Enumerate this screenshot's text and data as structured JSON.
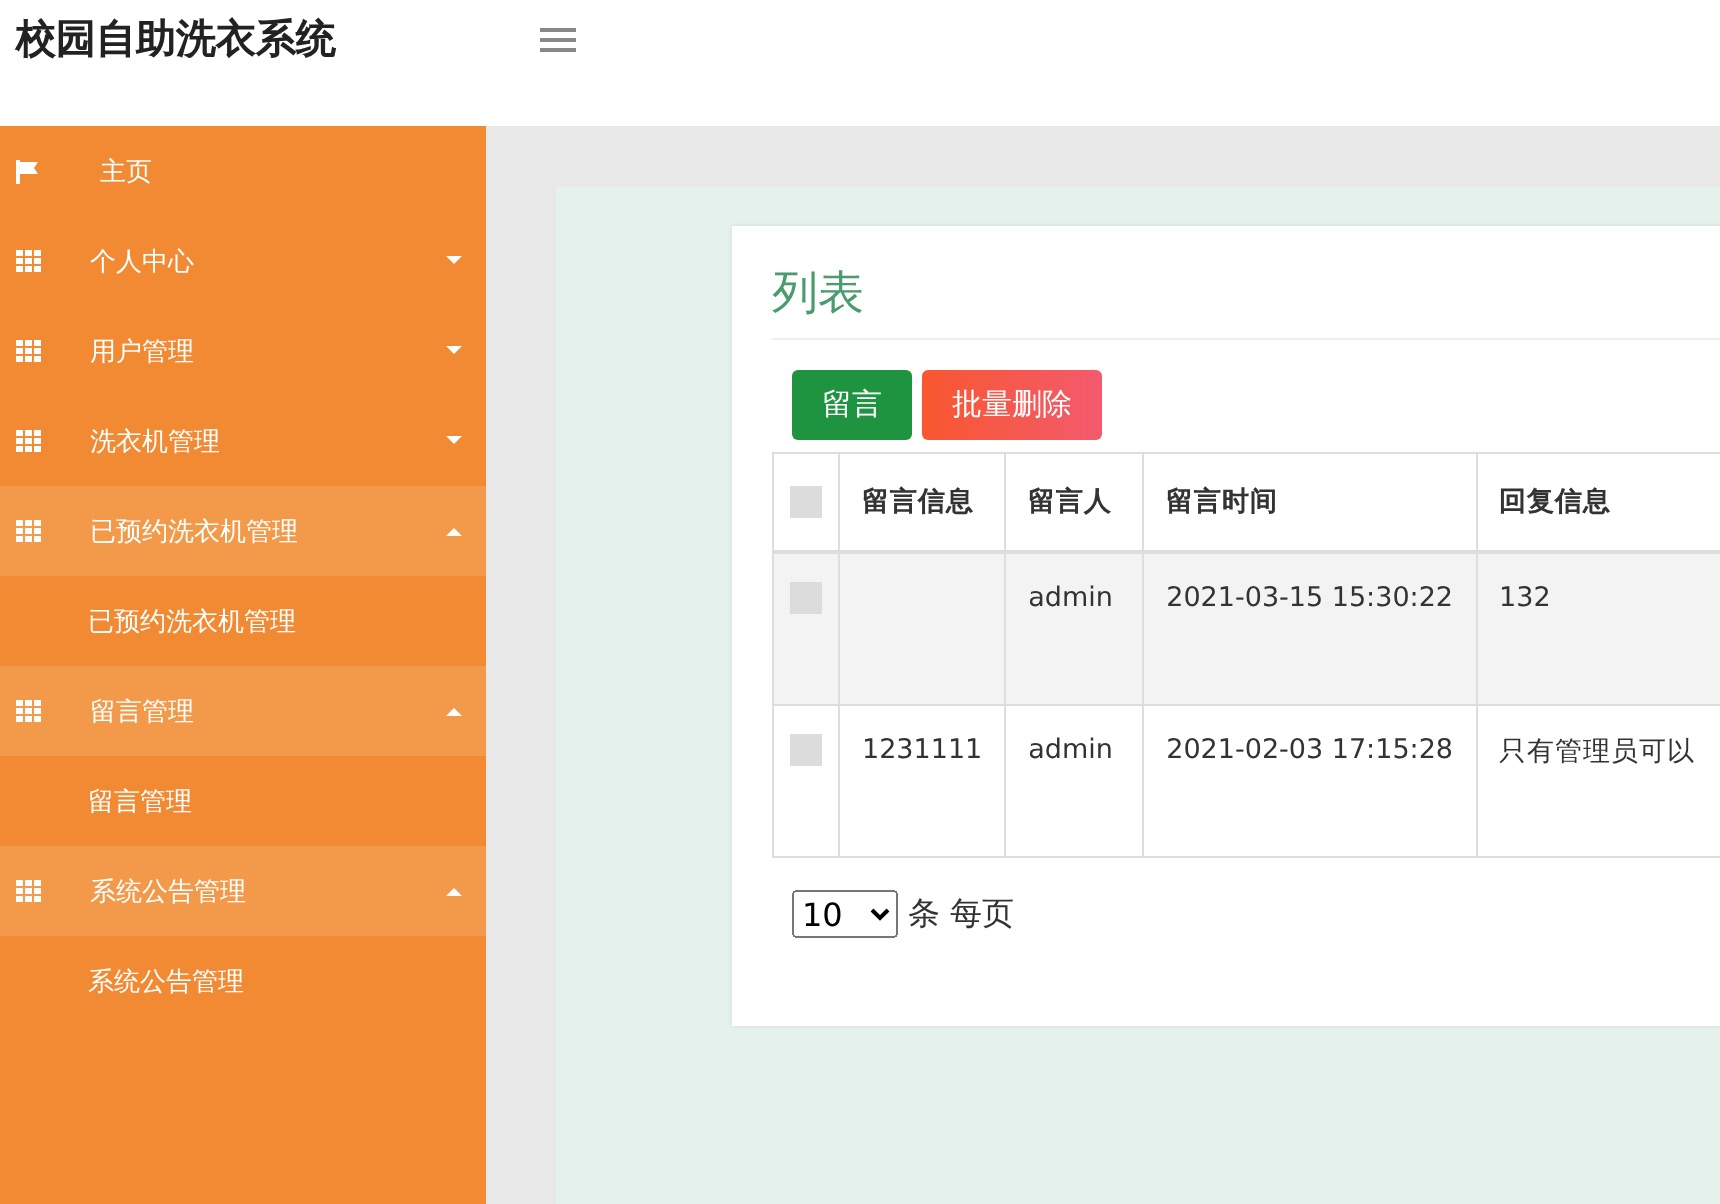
{
  "header": {
    "title": "校园自助洗衣系统"
  },
  "sidebar": {
    "items": [
      {
        "kind": "home",
        "label": "主页",
        "expanded": false
      },
      {
        "kind": "group",
        "label": "个人中心",
        "expanded": false
      },
      {
        "kind": "group",
        "label": "用户管理",
        "expanded": false
      },
      {
        "kind": "group",
        "label": "洗衣机管理",
        "expanded": false
      },
      {
        "kind": "group",
        "label": "已预约洗衣机管理",
        "expanded": true,
        "children": [
          {
            "label": "已预约洗衣机管理"
          }
        ]
      },
      {
        "kind": "group",
        "label": "留言管理",
        "expanded": true,
        "children": [
          {
            "label": "留言管理"
          }
        ]
      },
      {
        "kind": "group",
        "label": "系统公告管理",
        "expanded": true,
        "children": [
          {
            "label": "系统公告管理"
          }
        ]
      }
    ]
  },
  "card": {
    "title": "列表",
    "buttons": [
      {
        "kind": "add",
        "label": "留言"
      },
      {
        "kind": "delete",
        "label": "批量删除"
      }
    ],
    "table": {
      "select_all": {
        "checked": false
      },
      "columns": [
        "留言信息",
        "留言人",
        "留言时间",
        "回复信息"
      ],
      "rows": [
        {
          "checked": false,
          "cells": [
            "",
            "admin",
            "2021-03-15 15:30:22",
            "132"
          ]
        },
        {
          "checked": false,
          "cells": [
            "1231111",
            "admin",
            "2021-02-03 17:15:28",
            "只有管理员可以"
          ]
        }
      ]
    },
    "page_size": {
      "value": "10",
      "suffix": "条 每页"
    }
  }
}
